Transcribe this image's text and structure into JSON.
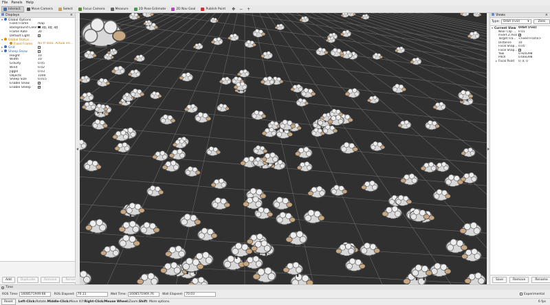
{
  "menu": [
    "File",
    "Panels",
    "Help"
  ],
  "toolbar": {
    "tools": [
      {
        "label": "Interact",
        "icon": "cursor-icon",
        "color": "#3b6fb6",
        "active": true
      },
      {
        "label": "Move Camera",
        "icon": "move-camera-icon",
        "color": "#555555"
      },
      {
        "label": "Select",
        "icon": "select-icon",
        "color": "#c9a24a"
      },
      {
        "label": "Focus Camera",
        "icon": "focus-camera-icon",
        "color": "#5a8a3a"
      },
      {
        "label": "Measure",
        "icon": "measure-icon",
        "color": "#666666"
      },
      {
        "label": "2D Pose Estimate",
        "icon": "pose-estimate-icon",
        "color": "#3aa04a"
      },
      {
        "label": "2D Nav Goal",
        "icon": "nav-goal-icon",
        "color": "#c040c0"
      },
      {
        "label": "Publish Point",
        "icon": "publish-point-icon",
        "color": "#d03030"
      }
    ],
    "extra": [
      "✥",
      "−",
      "+"
    ]
  },
  "displays": {
    "title": "Displays",
    "rows": [
      {
        "indent": 0,
        "arrow": "▾",
        "icon": "gear-icon",
        "key": "Global Options",
        "value": "",
        "cls": ""
      },
      {
        "indent": 1,
        "key": "Fixed Frame",
        "value": "map",
        "cls": ""
      },
      {
        "indent": 1,
        "key": "Background Color",
        "value": "48; 48; 48",
        "swatch": true,
        "cls": ""
      },
      {
        "indent": 1,
        "key": "Frame Rate",
        "value": "30",
        "cls": ""
      },
      {
        "indent": 1,
        "key": "Default Light",
        "value": "",
        "check": true,
        "cls": ""
      },
      {
        "indent": 0,
        "arrow": "▾",
        "icon": "warning-icon",
        "key": "Global Status: ...",
        "value": "",
        "cls": "orange"
      },
      {
        "indent": 1,
        "icon": "warning-icon",
        "key": "Fixed Frame",
        "value": "No tf data.  Actual err...",
        "cls": "orange"
      },
      {
        "indent": 0,
        "arrow": "▸",
        "icon": "grid-icon",
        "key": "Grid",
        "value": "",
        "check": true,
        "cls": "blue"
      },
      {
        "indent": 0,
        "arrow": "▾",
        "icon": "sheep-icon",
        "key": "Sheep-Snow",
        "value": "",
        "check": true,
        "cls": "blue"
      },
      {
        "indent": 1,
        "key": "Height",
        "value": "10",
        "cls": ""
      },
      {
        "indent": 1,
        "key": "Width",
        "value": "10",
        "cls": ""
      },
      {
        "indent": 1,
        "key": "Gravity",
        "value": "0.05",
        "cls": ""
      },
      {
        "indent": 1,
        "key": "Wind",
        "value": "0.02",
        "cls": ""
      },
      {
        "indent": 1,
        "key": "Jiggle",
        "value": "0.03",
        "cls": ""
      },
      {
        "indent": 1,
        "key": "Objects",
        "value": "1000",
        "cls": ""
      },
      {
        "indent": 1,
        "key": "Sheep Size",
        "value": "0.015",
        "cls": ""
      },
      {
        "indent": 1,
        "key": "Enable Snow",
        "value": "",
        "check": true,
        "cls": ""
      },
      {
        "indent": 1,
        "key": "Enable Sheep",
        "value": "",
        "check": true,
        "cls": ""
      }
    ],
    "buttons": [
      {
        "label": "Add",
        "disabled": false
      },
      {
        "label": "Duplicate",
        "disabled": true
      },
      {
        "label": "Remove",
        "disabled": true
      },
      {
        "label": "Rename",
        "disabled": true
      }
    ]
  },
  "views": {
    "title": "Views",
    "type_label": "Type:",
    "type_value": "Orbit (rviz)",
    "zero_label": "Zero",
    "rows": [
      {
        "indent": 0,
        "arrow": "▾",
        "key": "Current View",
        "value": "Orbit (rviz)",
        "bold": true
      },
      {
        "indent": 1,
        "key": "Near Clip ...",
        "value": "0.01"
      },
      {
        "indent": 1,
        "key": "Invert Z Axis",
        "value": "",
        "check": true
      },
      {
        "indent": 1,
        "key": "Target Fra...",
        "value": "<Fixed Frame>"
      },
      {
        "indent": 1,
        "key": "Distance",
        "value": "10"
      },
      {
        "indent": 1,
        "key": "Focal Shap...",
        "value": "0.05"
      },
      {
        "indent": 1,
        "key": "Focal Shap...",
        "value": "",
        "check": true
      },
      {
        "indent": 1,
        "key": "Yaw",
        "value": "0.920398"
      },
      {
        "indent": 1,
        "key": "Pitch",
        "value": "0.660398"
      },
      {
        "indent": 1,
        "arrow": "▸",
        "key": "Focal Point",
        "value": "0; 0; 0"
      }
    ],
    "buttons": [
      "Save",
      "Remove",
      "Rename"
    ]
  },
  "time": {
    "title": "Time",
    "ros_time_label": "ROS Time:",
    "ros_time": "1608571949.68",
    "ros_elapsed_label": "ROS Elapsed:",
    "ros_elapsed": "70.11",
    "wall_time_label": "Wall Time:",
    "wall_time": "1608571949.76",
    "wall_elapsed_label": "Wall Elapsed:",
    "wall_elapsed": "70.03",
    "experimental_label": "Experimental"
  },
  "status": {
    "reset_label": "Reset",
    "left_click": "Left-Click:",
    "left_click_desc": " Rotate. ",
    "middle_click": "Middle-Click:",
    "middle_click_desc": " Move X/Y. ",
    "right_click": "Right-Click/Mouse Wheel:",
    "right_click_desc": " Zoom. ",
    "shift": "Shift",
    "shift_desc": ": More options.",
    "fps": "6 fps"
  }
}
